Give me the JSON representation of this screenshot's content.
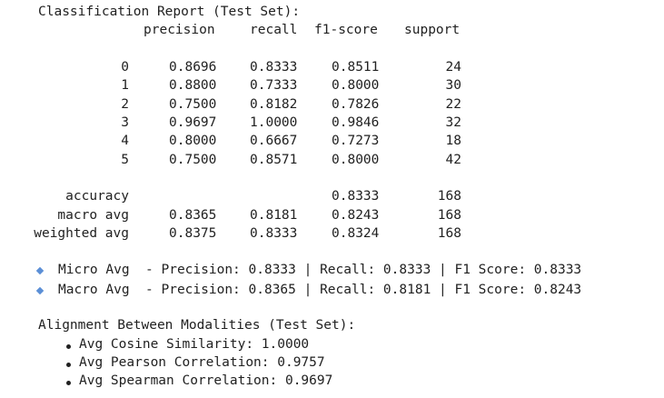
{
  "report": {
    "title": "Classification Report (Test Set):",
    "headers": {
      "precision": "precision",
      "recall": "recall",
      "f1": "f1-score",
      "support": "support"
    },
    "rows": [
      {
        "label": "0",
        "precision": "0.8696",
        "recall": "0.8333",
        "f1": "0.8511",
        "support": "24"
      },
      {
        "label": "1",
        "precision": "0.8800",
        "recall": "0.7333",
        "f1": "0.8000",
        "support": "30"
      },
      {
        "label": "2",
        "precision": "0.7500",
        "recall": "0.8182",
        "f1": "0.7826",
        "support": "22"
      },
      {
        "label": "3",
        "precision": "0.9697",
        "recall": "1.0000",
        "f1": "0.9846",
        "support": "32"
      },
      {
        "label": "4",
        "precision": "0.8000",
        "recall": "0.6667",
        "f1": "0.7273",
        "support": "18"
      },
      {
        "label": "5",
        "precision": "0.7500",
        "recall": "0.8571",
        "f1": "0.8000",
        "support": "42"
      }
    ],
    "accuracy": {
      "label": "accuracy",
      "f1": "0.8333",
      "support": "168"
    },
    "macro": {
      "label": "macro avg",
      "precision": "0.8365",
      "recall": "0.8181",
      "f1": "0.8243",
      "support": "168"
    },
    "weighted": {
      "label": "weighted avg",
      "precision": "0.8375",
      "recall": "0.8333",
      "f1": "0.8324",
      "support": "168"
    }
  },
  "summary": {
    "bullet_color": "#5b8fd6",
    "micro": "Micro Avg  - Precision: 0.8333 | Recall: 0.8333 | F1 Score: 0.8333",
    "macro": "Macro Avg  - Precision: 0.8365 | Recall: 0.8181 | F1 Score: 0.8243"
  },
  "alignment": {
    "title": "Alignment Between Modalities (Test Set):",
    "items": [
      "Avg Cosine Similarity: 1.0000",
      "Avg Pearson Correlation: 0.9757",
      "Avg Spearman Correlation: 0.9697"
    ]
  }
}
